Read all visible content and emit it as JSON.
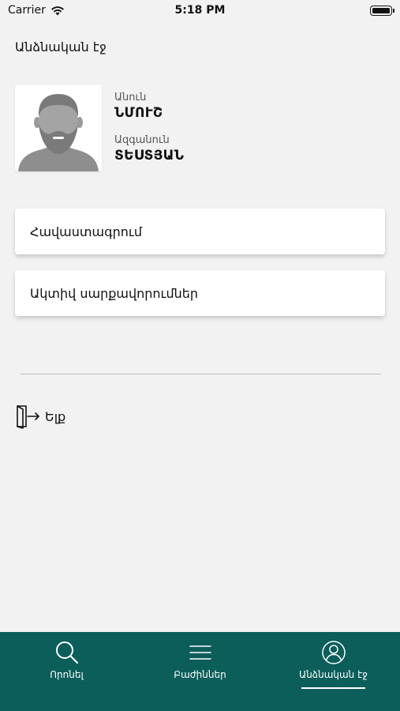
{
  "status_bar": {
    "carrier": "Carrier",
    "time": "5:18 PM"
  },
  "page": {
    "title": "Անձնական էջ"
  },
  "profile": {
    "name_label": "Անուն",
    "name_value": "ՆՄՈՒՇ",
    "surname_label": "Ազգանուն",
    "surname_value": "ՏԵՍՏՅԱՆ"
  },
  "menu": {
    "items": [
      {
        "label": "Հավաստագրում"
      },
      {
        "label": "Ակտիվ սարքավորումներ"
      }
    ]
  },
  "logout": {
    "label": "Ելք",
    "icon": "logout-icon"
  },
  "tab_bar": {
    "background": "#0c5e5a",
    "tabs": [
      {
        "label": "Որոնել",
        "icon": "search-icon"
      },
      {
        "label": "Բաժիններ",
        "icon": "menu-icon"
      },
      {
        "label": "Անձնական էջ",
        "icon": "profile-icon",
        "active": true
      }
    ]
  }
}
